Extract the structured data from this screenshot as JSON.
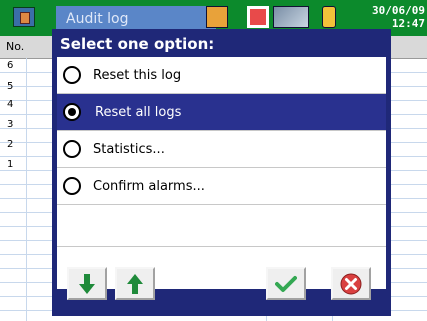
{
  "window": {
    "title": "Audit log",
    "date": "30/06/09",
    "time": "12:47"
  },
  "table": {
    "column_header": "No.",
    "rows": [
      "6",
      "5",
      "4",
      "3",
      "2",
      "1"
    ]
  },
  "dialog": {
    "title": "Select one option:",
    "options": [
      {
        "label": "Reset this log",
        "selected": false
      },
      {
        "label": "Reset all logs",
        "selected": true
      },
      {
        "label": "Statistics...",
        "selected": false
      },
      {
        "label": "Confirm alarms...",
        "selected": false
      }
    ],
    "buttons": {
      "down": "arrow-down-icon",
      "up": "arrow-up-icon",
      "ok": "checkmark-icon",
      "cancel": "cancel-icon"
    }
  },
  "colors": {
    "topbar": "#0c8a2c",
    "dialog": "#1f2878",
    "selected": "#29318f",
    "arrows": "#1f8a3a",
    "cancel": "#d94040"
  }
}
